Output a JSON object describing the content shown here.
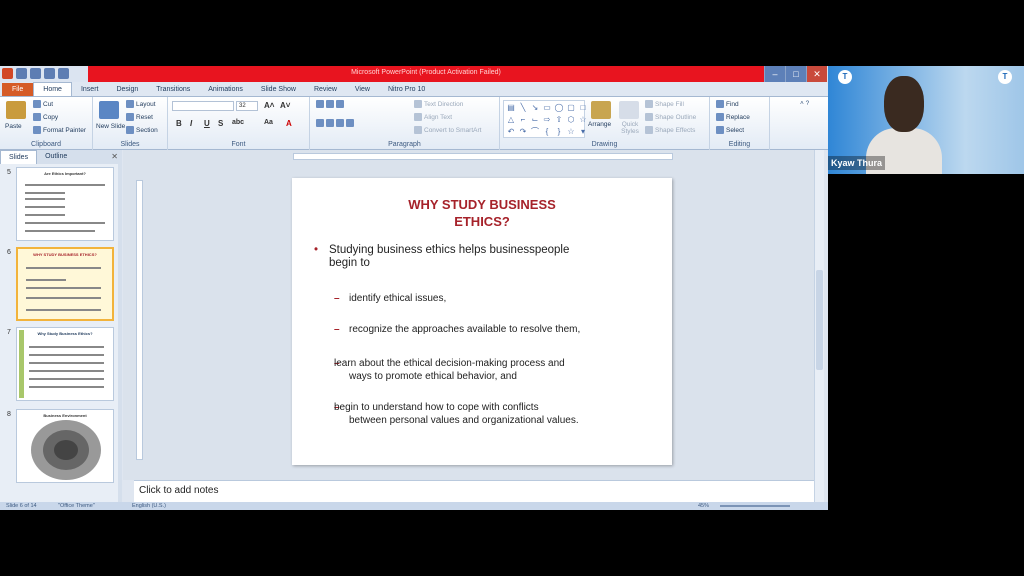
{
  "window": {
    "title": "Microsoft PowerPoint (Product Activation Failed)"
  },
  "ribbon_tabs": [
    "File",
    "Home",
    "Insert",
    "Design",
    "Transitions",
    "Animations",
    "Slide Show",
    "Review",
    "View",
    "Nitro Pro 10"
  ],
  "clipboard": {
    "paste": "Paste",
    "cut": "Cut",
    "copy": "Copy",
    "format_painter": "Format Painter",
    "label": "Clipboard"
  },
  "slides_group": {
    "new_slide": "New Slide",
    "layout": "Layout",
    "reset": "Reset",
    "section": "Section",
    "label": "Slides"
  },
  "font_group": {
    "size": "32",
    "label": "Font"
  },
  "paragraph_group": {
    "text_direction": "Text Direction",
    "align_text": "Align Text",
    "smartart": "Convert to SmartArt",
    "label": "Paragraph"
  },
  "drawing_group": {
    "arrange": "Arrange",
    "quick_styles": "Quick Styles",
    "shape_fill": "Shape Fill",
    "shape_outline": "Shape Outline",
    "shape_effects": "Shape Effects",
    "label": "Drawing"
  },
  "editing_group": {
    "find": "Find",
    "replace": "Replace",
    "select": "Select",
    "label": "Editing"
  },
  "pane_tabs": {
    "slides": "Slides",
    "outline": "Outline"
  },
  "thumbnails": [
    {
      "num": "5",
      "title": "Are Ethics Important?"
    },
    {
      "num": "6",
      "title": "WHY STUDY BUSINESS ETHICS?"
    },
    {
      "num": "7",
      "title": "Why Study Business Ethics?"
    },
    {
      "num": "8",
      "title": "Business Environment"
    }
  ],
  "slide": {
    "title": "WHY STUDY BUSINESS\nETHICS?",
    "bullet": "Studying  business  ethics  helps  businesspeople\nbegin to",
    "subs": [
      "identify ethical issues,",
      "recognize the approaches available to resolve them,",
      "learn about the ethical decision-making process and\nways to promote ethical behavior, and",
      "begin to understand how to cope with conflicts\nbetween personal values and organizational values."
    ]
  },
  "notes_placeholder": "Click to add notes",
  "status": {
    "slide_info": "Slide 6 of 14",
    "theme": "\"Office Theme\"",
    "language": "English (U.S.)",
    "zoom": "45%"
  },
  "webcam": {
    "participant_name": "Kyaw Thura"
  },
  "colors": {
    "title_red": "#a6222a",
    "titlebar_red": "#e8141f",
    "file_tab": "#d55b26"
  }
}
